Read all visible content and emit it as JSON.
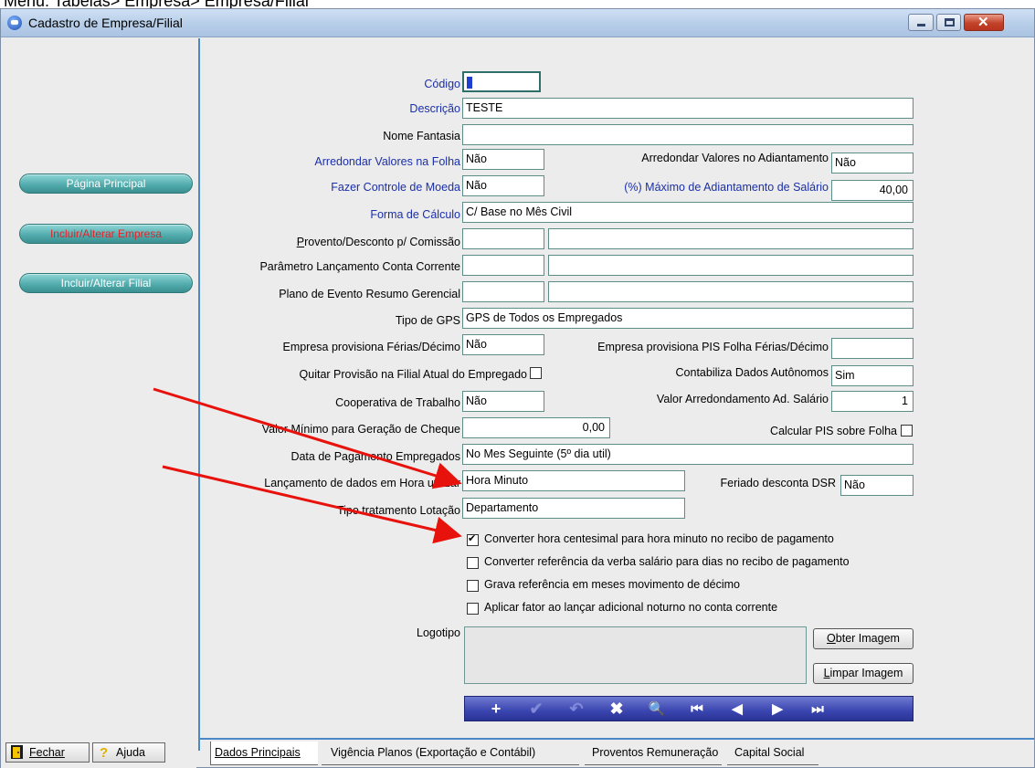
{
  "menu_path": "Menu: Tabelas> Empresa> Empresa/Filial",
  "window": {
    "title": "Cadastro de Empresa/Filial",
    "minimize": "–",
    "maximize": "□",
    "close": "✕"
  },
  "sidebar": {
    "items": [
      {
        "label": "Página Principal",
        "active": false
      },
      {
        "label": "Incluir/Alterar Empresa",
        "active": true
      },
      {
        "label": "Incluir/Alterar Filial",
        "active": false
      }
    ],
    "close_btn": {
      "label": "Fechar",
      "hotkey": "F"
    },
    "help_btn": {
      "label": "Ajuda"
    }
  },
  "form": {
    "codigo": {
      "label": "Código",
      "value": ""
    },
    "descricao": {
      "label": "Descrição",
      "value": "TESTE"
    },
    "nome_fantasia": {
      "label": "Nome Fantasia",
      "value": ""
    },
    "arredondar_folha": {
      "label": "Arredondar Valores na Folha",
      "value": "Não"
    },
    "arredondar_adiant": {
      "label": "Arredondar Valores no Adiantamento",
      "value": "Não"
    },
    "controle_moeda": {
      "label": "Fazer Controle de Moeda",
      "value": "Não"
    },
    "max_adiant": {
      "label": "(%) Máximo de Adiantamento de Salário",
      "value": "40,00"
    },
    "forma_calculo": {
      "label": "Forma de Cálculo",
      "value": "C/ Base no Mês Civil"
    },
    "provento_comissao": {
      "label": "Provento/Desconto p/ Comissão",
      "value": ""
    },
    "param_conta": {
      "label": "Parâmetro Lançamento Conta Corrente",
      "value": ""
    },
    "plano_evento": {
      "label": "Plano de Evento Resumo Gerencial",
      "value": ""
    },
    "tipo_gps": {
      "label": "Tipo de GPS",
      "value": "GPS de Todos os Empregados"
    },
    "prov_ferias": {
      "label": "Empresa provisiona Férias/Décimo",
      "value": "Não"
    },
    "prov_pis": {
      "label": "Empresa provisiona PIS Folha Férias/Décimo",
      "value": ""
    },
    "quitar_prov": {
      "label": "Quitar Provisão na Filial Atual do Empregado",
      "checked": false
    },
    "contab_auto": {
      "label": "Contabiliza Dados Autônomos",
      "value": "Sim"
    },
    "cooperativa": {
      "label": "Cooperativa de Trabalho",
      "value": "Não"
    },
    "valor_arred": {
      "label": "Valor Arredondamento Ad. Salário",
      "value": "1"
    },
    "valor_minimo": {
      "label": "Valor Mínimo para Geração de Cheque",
      "value": "0,00"
    },
    "calc_pis": {
      "label": "Calcular PIS sobre Folha",
      "checked": false
    },
    "data_pagamento": {
      "label": "Data de Pagamento Empregados",
      "value": "No Mes Seguinte (5º dia util)"
    },
    "lanc_hora": {
      "label": "Lançamento de dados em Hora utilizar",
      "value": "Hora Minuto"
    },
    "feriado_dsr": {
      "label": "Feriado desconta DSR",
      "value": "Não"
    },
    "tipo_lotacao": {
      "label": "Tipo tratamento Lotação",
      "value": "Departamento"
    },
    "opts": [
      {
        "label": "Converter hora centesimal para hora minuto no recibo de pagamento",
        "checked": true
      },
      {
        "label": "Converter referência da verba salário para dias no recibo de pagamento",
        "checked": false
      },
      {
        "label": "Grava referência em meses movimento de décimo",
        "checked": false
      },
      {
        "label": "Aplicar fator ao lançar adicional noturno no conta corrente",
        "checked": false
      }
    ],
    "logotipo": {
      "label": "Logotipo",
      "obter": "Obter Imagem",
      "limpar": "Limpar Imagem"
    }
  },
  "toolbar": {
    "add": "+",
    "confirm": "✔",
    "undo": "↶",
    "cancel": "✖",
    "search": "🔍",
    "first": "⏮",
    "prev": "◀",
    "next": "▶",
    "last": "⏭"
  },
  "tabs": [
    {
      "label": "Dados Principais",
      "active": true
    },
    {
      "label": "Vigência Planos (Exportação e Contábil)",
      "active": false
    },
    {
      "label": "Proventos Remuneração",
      "active": false
    },
    {
      "label": "Capital Social",
      "active": false
    }
  ]
}
